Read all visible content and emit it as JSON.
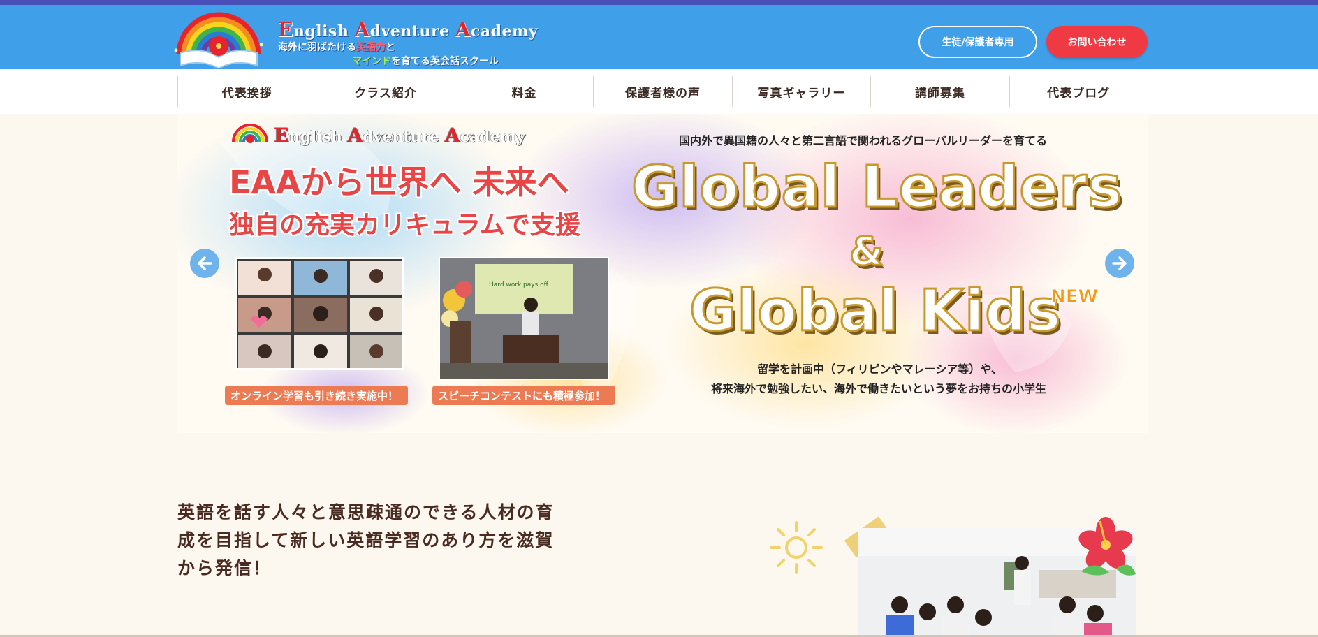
{
  "header": {
    "brand_parts": [
      "E",
      "nglish ",
      "A",
      "dventure ",
      "A",
      "cademy"
    ],
    "tagline1_a": "海外に羽ばたける",
    "tagline1_b": "英語力",
    "tagline1_c": "と",
    "tagline2_a": "マインド",
    "tagline2_b": "を育てる英会話スクール",
    "member_button": "生徒/保護者専用",
    "contact_button": "お問い合わせ"
  },
  "nav": {
    "items": [
      "代表挨拶",
      "クラス紹介",
      "料金",
      "保護者様の声",
      "写真ギャラリー",
      "講師募集",
      "代表ブログ"
    ]
  },
  "hero": {
    "brand_parts": [
      "E",
      "nglish ",
      "A",
      "dventure ",
      "A",
      "cademy"
    ],
    "headline1": "EAAから世界へ 未来へ",
    "headline2": "独自の充実カリキュラムで支援",
    "subtitle": "国内外で異国籍の人々と第二言語で関われるグローバルリーダーを育てる",
    "big1": "Global Leaders",
    "big2": "&",
    "big3": "Global Kids",
    "badge": "NEW",
    "desc1": "留学を計画中（フィリピンやマレーシア等）や、",
    "desc2": "将来海外で勉強したい、海外で働きたいという夢をお持ちの小学生",
    "caption1": "オンライン学習も引き続き実施中！",
    "caption2": "スピーチコンテストにも積極参加！",
    "slide_text": "Hard work pays off"
  },
  "intro": {
    "text": "英語を話す人々と意思疎通のできる人材の育成を目指して新しい英語学習のあり方を滋賀から発信！"
  },
  "colors": {
    "header_bg": "#3f9fe9",
    "top_stripe": "#4a4fb8",
    "contact_bg": "#ef3a43",
    "page_bg": "#fdf8ef",
    "caption_bg": "#ec7a52",
    "headline_red": "#e84646"
  },
  "icons": {
    "prev": "arrow-left-icon",
    "next": "arrow-right-icon",
    "logo": "rainbow-book-logo-icon",
    "sun": "sun-doodle-icon",
    "flower": "hibiscus-icon"
  }
}
